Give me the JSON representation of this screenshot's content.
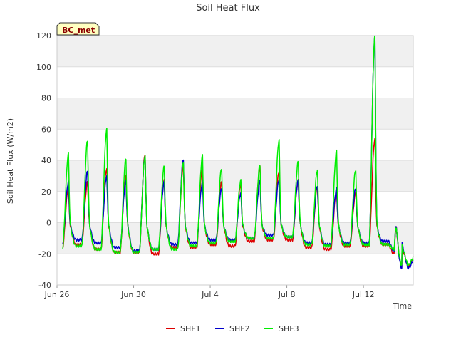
{
  "chart_data": {
    "type": "line",
    "title": "Soil Heat Flux",
    "xlabel": "Time",
    "ylabel": "Soil Heat Flux (W/m2)",
    "ylim": [
      -40,
      120
    ],
    "xlim": [
      0,
      18.6
    ],
    "x_unit": "days since Jun 26",
    "yticks": [
      -40,
      -20,
      0,
      20,
      40,
      60,
      80,
      100,
      120
    ],
    "xticks": [
      {
        "label": "Jun 26",
        "value": 0
      },
      {
        "label": "Jun 30",
        "value": 4
      },
      {
        "label": "Jul 4",
        "value": 8
      },
      {
        "label": "Jul 8",
        "value": 12
      },
      {
        "label": "Jul 12",
        "value": 16
      }
    ],
    "station_label": "BC_met",
    "grid": true,
    "legend_position": "bottom-center",
    "series": [
      {
        "name": "SHF1",
        "color": "#dd0000",
        "daily_min": [
          -16,
          -14,
          -17,
          -19,
          -19,
          -20,
          -16,
          -16,
          -14,
          -15,
          -12,
          -11,
          -11,
          -16,
          -17,
          -15,
          -15,
          -14,
          -28
        ],
        "daily_max": [
          22,
          26,
          35,
          30,
          44,
          27,
          36,
          36,
          26,
          25,
          36,
          33,
          27,
          23,
          20,
          19,
          54,
          -20,
          -20
        ]
      },
      {
        "name": "SHF2",
        "color": "#0000cc",
        "daily_min": [
          -13,
          -11,
          -13,
          -16,
          -18,
          -17,
          -14,
          -13,
          -11,
          -11,
          -10,
          -8,
          -9,
          -13,
          -14,
          -13,
          -13,
          -12,
          -29
        ],
        "daily_max": [
          26,
          33,
          30,
          27,
          43,
          26,
          41,
          26,
          22,
          19,
          27,
          28,
          27,
          24,
          22,
          22,
          120,
          -18,
          -18
        ]
      },
      {
        "name": "SHF3",
        "color": "#00ee00",
        "daily_min": [
          -16,
          -15,
          -17,
          -19,
          -19,
          -17,
          -17,
          -15,
          -13,
          -12,
          -10,
          -10,
          -9,
          -14,
          -15,
          -14,
          -14,
          -14,
          -27
        ],
        "daily_max": [
          44,
          53,
          60,
          41,
          43,
          36,
          39,
          43,
          35,
          27,
          37,
          53,
          39,
          34,
          46,
          34,
          120,
          -17,
          -17
        ]
      }
    ]
  }
}
